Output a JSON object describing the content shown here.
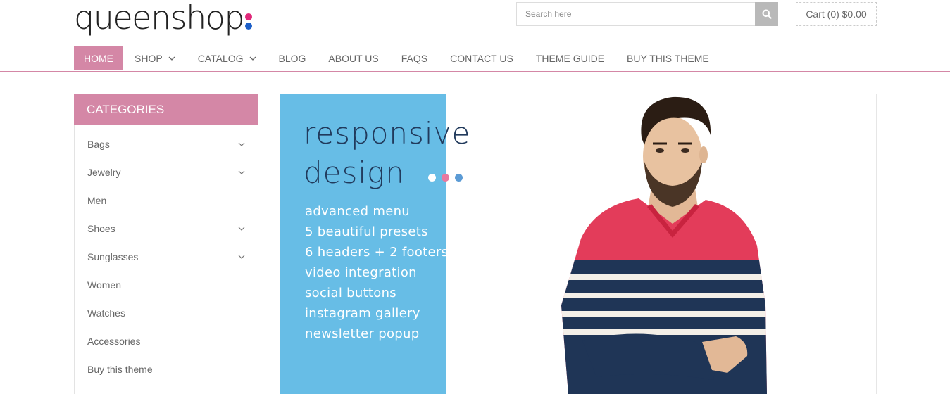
{
  "logo": {
    "text": "queenshop",
    "dot_colors": [
      "#e0297a",
      "#1d5fc8"
    ]
  },
  "search": {
    "placeholder": "Search here"
  },
  "cart": {
    "label": "Cart (0) $0.00"
  },
  "nav": {
    "items": [
      {
        "label": "HOME",
        "active": true,
        "dropdown": false
      },
      {
        "label": "SHOP",
        "active": false,
        "dropdown": true
      },
      {
        "label": "CATALOG",
        "active": false,
        "dropdown": true
      },
      {
        "label": "BLOG",
        "active": false,
        "dropdown": false
      },
      {
        "label": "ABOUT US",
        "active": false,
        "dropdown": false
      },
      {
        "label": "FAQS",
        "active": false,
        "dropdown": false
      },
      {
        "label": "CONTACT US",
        "active": false,
        "dropdown": false
      },
      {
        "label": "THEME GUIDE",
        "active": false,
        "dropdown": false
      },
      {
        "label": "BUY THIS THEME",
        "active": false,
        "dropdown": false
      }
    ]
  },
  "categories": {
    "title": "CATEGORIES",
    "items": [
      {
        "label": "Bags",
        "expandable": true
      },
      {
        "label": "Jewelry",
        "expandable": true
      },
      {
        "label": "Men",
        "expandable": false
      },
      {
        "label": "Shoes",
        "expandable": true
      },
      {
        "label": "Sunglasses",
        "expandable": true
      },
      {
        "label": "Women",
        "expandable": false
      },
      {
        "label": "Watches",
        "expandable": false
      },
      {
        "label": "Accessories",
        "expandable": false
      },
      {
        "label": "Buy this theme",
        "expandable": false
      }
    ]
  },
  "slider": {
    "title_line1": "responsive",
    "title_line2": "design",
    "features": [
      "advanced menu",
      "5 beautiful presets",
      "6 headers + 2 footers",
      "video integration",
      "social buttons",
      "instagram gallery",
      "newsletter popup"
    ],
    "dot_colors": [
      "#ffffff",
      "#e8799f",
      "#5b9bd5"
    ]
  },
  "colors": {
    "accent": "#d487a6",
    "slide_blue": "#67bde6",
    "title_navy": "#213a5c"
  }
}
